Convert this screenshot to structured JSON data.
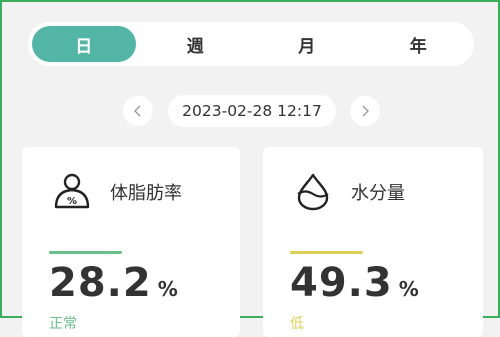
{
  "tabs": [
    {
      "label": "日",
      "active": true
    },
    {
      "label": "週",
      "active": false
    },
    {
      "label": "月",
      "active": false
    },
    {
      "label": "年",
      "active": false
    }
  ],
  "date": {
    "value": "2023-02-28 12:17",
    "prev_icon": "chevron-left-icon",
    "next_icon": "chevron-right-icon"
  },
  "cards": [
    {
      "title": "体脂肪率",
      "icon": "body-fat-person-icon",
      "value": "28.2",
      "unit": "%",
      "status": "正常",
      "bar_color": "#6abf8a",
      "status_color": "#6abf8a"
    },
    {
      "title": "水分量",
      "icon": "water-drop-icon",
      "value": "49.3",
      "unit": "%",
      "status": "低",
      "bar_color": "#e0cf55",
      "status_color": "#e0cf55"
    }
  ],
  "colors": {
    "accent": "#53b5a6",
    "frame": "#3aae5a",
    "background": "#f2f2f2"
  }
}
